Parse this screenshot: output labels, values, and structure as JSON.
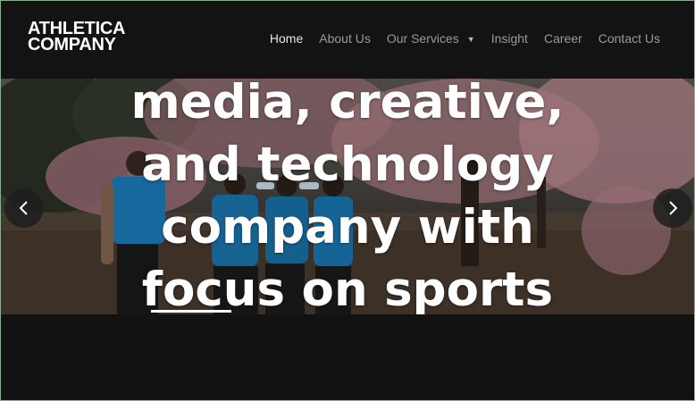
{
  "brand": {
    "line1": "ATHLETICA",
    "line2": "COMPANY"
  },
  "nav": {
    "items": [
      {
        "label": "Home",
        "active": true
      },
      {
        "label": "About Us"
      },
      {
        "label": "Our Services",
        "dropdown": true
      },
      {
        "label": "Insight"
      },
      {
        "label": "Career"
      },
      {
        "label": "Contact Us"
      }
    ],
    "caret": "▼"
  },
  "hero": {
    "headline_lines": [
      "media, creative,",
      "and technology",
      "company with",
      "focus on sports"
    ],
    "prev_icon": "chevron-left-icon",
    "next_icon": "chevron-right-icon"
  },
  "colors": {
    "header_bg": "#131313",
    "nav_text": "#9a9a9a",
    "nav_active": "#e6e6e6",
    "headline": "#ffffff",
    "jersey": "#1d7fbf"
  }
}
